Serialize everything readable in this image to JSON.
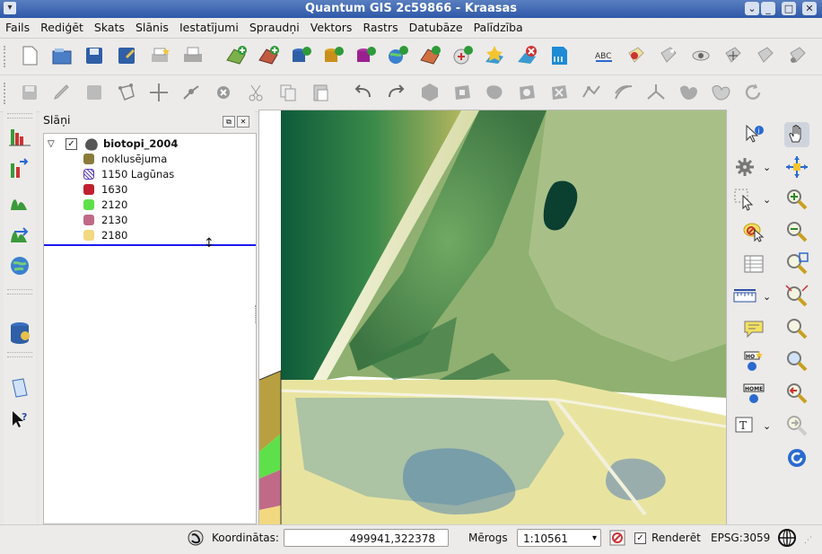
{
  "window": {
    "title": "Quantum GIS 2c59866 - Kraasas"
  },
  "menu": [
    "Fails",
    "Rediģēt",
    "Skats",
    "Slānis",
    "Iestatījumi",
    "Spraudņi",
    "Vektors",
    "Rastrs",
    "Datubāze",
    "Palīdzība"
  ],
  "layers_panel": {
    "title": "Slāņi",
    "layer": {
      "name": "biotopi_2004",
      "checked": true,
      "classes": [
        {
          "label": "noklusējuma",
          "color": "#8a7a3a"
        },
        {
          "label": "1150 Lagūnas",
          "color": "#5a3fb8"
        },
        {
          "label": "1630",
          "color": "#c02030"
        },
        {
          "label": "2120",
          "color": "#5ee04a"
        },
        {
          "label": "2130",
          "color": "#c06a88"
        },
        {
          "label": "2180",
          "color": "#f2d880"
        }
      ]
    }
  },
  "status": {
    "coordinates_label": "Koordinātas:",
    "coordinates_value": "499941,322378",
    "scale_label": "Mērogs",
    "scale_value": "1:10561",
    "render_label": "Renderēt",
    "render_checked": true,
    "crs": "EPSG:3059"
  },
  "colors": {
    "titlebar": "#2e58a8",
    "selection_line": "#1a1aee"
  }
}
